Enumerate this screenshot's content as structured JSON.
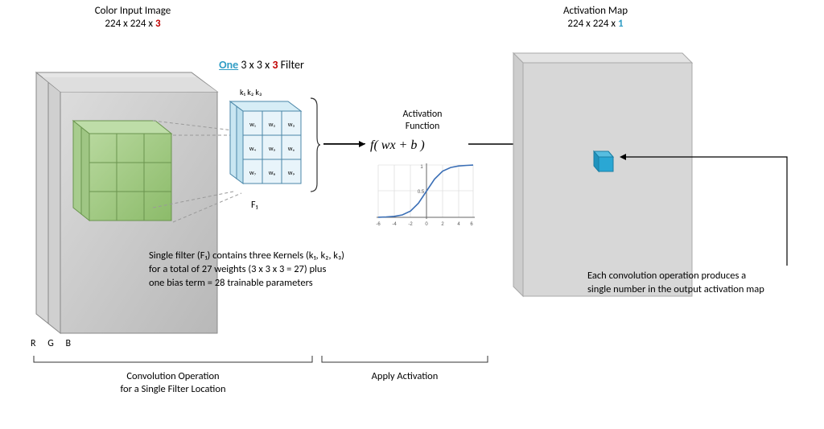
{
  "input": {
    "title": "Color Input Image",
    "dims_prefix": "224 x 224 x ",
    "dims_channels": "3",
    "channels": [
      "R",
      "G",
      "B"
    ]
  },
  "filter": {
    "count_word": "One",
    "rest_prefix": " 3 x 3 x ",
    "rest_channels": "3",
    "rest_suffix": " Filter",
    "kernel_labels": "k₁ k₂ k₃",
    "name": "F₁",
    "weights": [
      "w₁",
      "w₂",
      "w₃",
      "w₄",
      "w₅",
      "w₆",
      "w₇",
      "w₈",
      "w₉"
    ]
  },
  "activation": {
    "label": "Activation\nFunction",
    "formula": "f( wx + b )"
  },
  "output": {
    "title": "Activation Map",
    "dims_prefix": "224 x 224 x ",
    "dims_channels": "1",
    "caption": "Each convolution operation produces a\nsingle number in the output activation map"
  },
  "filter_desc": "Single filter (F₁) contains three Kernels (k₁, k₂, k₃)\nfor a total of 27 weights  (3 x 3 x 3 = 27)  plus\none bias term = 28 trainable parameters",
  "stage1": "Convolution Operation\nfor a Single Filter Location",
  "stage2": "Apply Activation",
  "chart_data": {
    "type": "line",
    "title": "",
    "xlabel": "",
    "ylabel": "",
    "x": [
      -6,
      -5,
      -4,
      -3,
      -2,
      -1,
      0,
      1,
      2,
      3,
      4,
      5,
      6
    ],
    "values": [
      0.002,
      0.007,
      0.018,
      0.047,
      0.119,
      0.269,
      0.5,
      0.731,
      0.881,
      0.953,
      0.982,
      0.993,
      0.998
    ],
    "x_ticks": [
      -6,
      -4,
      -2,
      0,
      2,
      4,
      6
    ],
    "y_ticks": [
      0.5,
      1
    ],
    "xlim": [
      -6,
      6
    ],
    "ylim": [
      0,
      1
    ]
  }
}
